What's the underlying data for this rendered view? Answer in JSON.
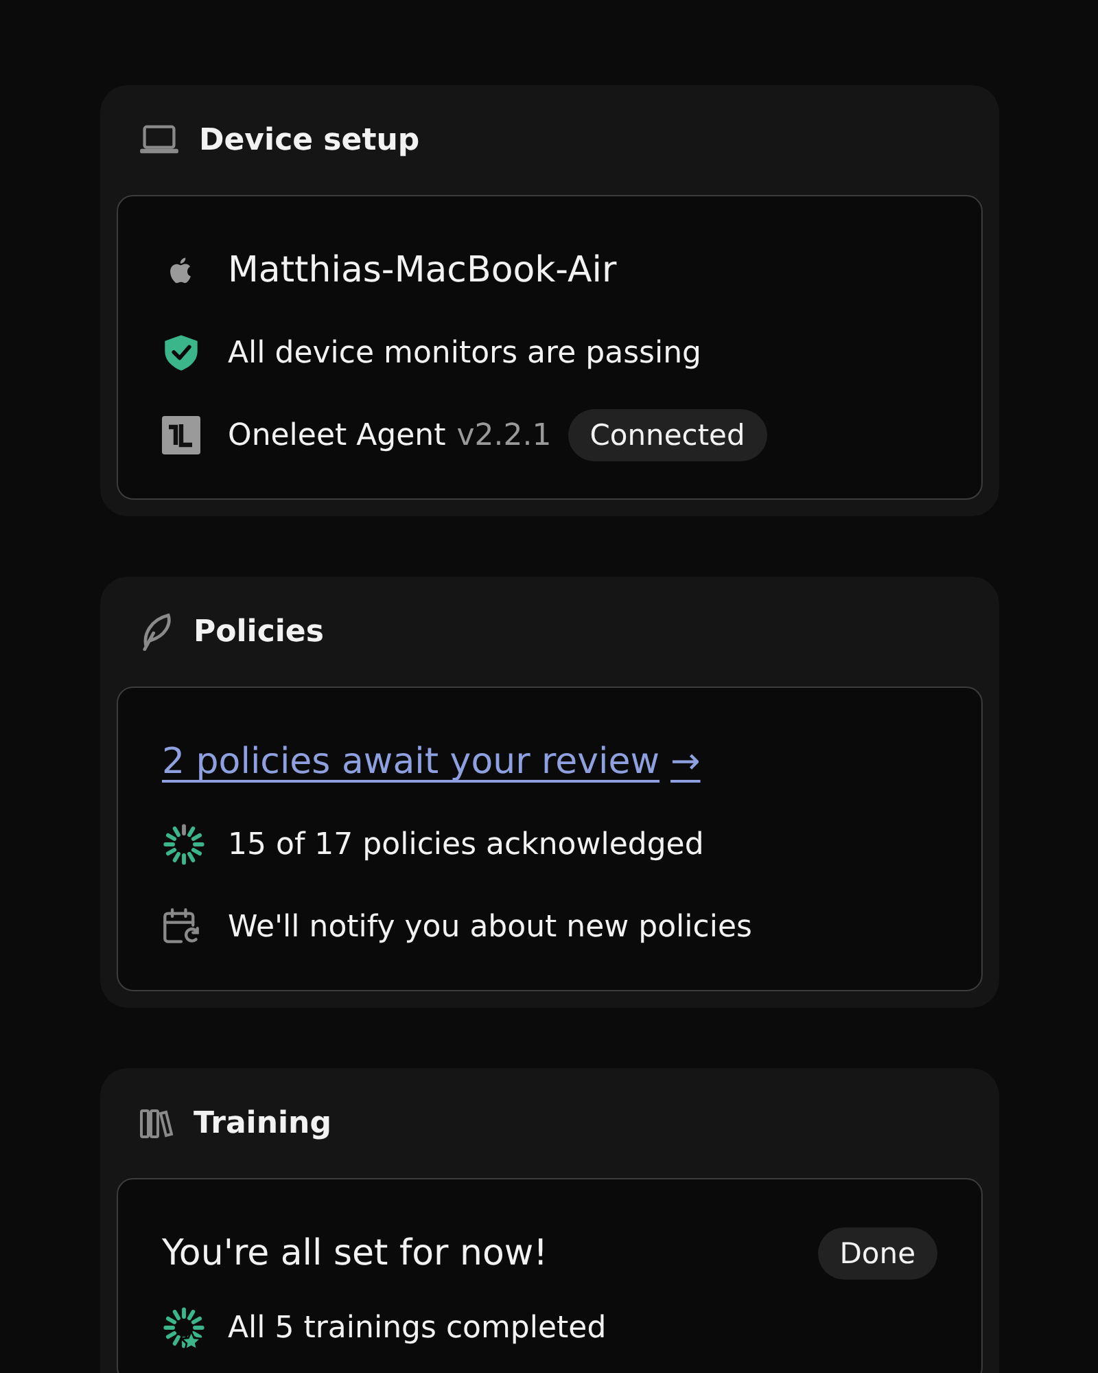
{
  "cards": [
    {
      "kind": "device",
      "title": "Device setup",
      "items": [
        {
          "kind": "device_name",
          "text": "Matthias-MacBook-Air"
        },
        {
          "kind": "shield",
          "text": "All device monitors are passing"
        },
        {
          "kind": "agent",
          "text": "Oneleet Agent",
          "version": "v2.2.1",
          "badge": "Connected"
        }
      ]
    },
    {
      "kind": "policies",
      "title": "Policies",
      "items": [
        {
          "kind": "link",
          "text": "2 policies await your review",
          "arrow": "→"
        },
        {
          "kind": "progress",
          "text": "15 of 17 policies acknowledged"
        },
        {
          "kind": "calendar",
          "text": "We'll notify you about new policies"
        }
      ]
    },
    {
      "kind": "training",
      "title": "Training",
      "items": [
        {
          "kind": "heading",
          "text": "You're all set for now!",
          "badge": "Done"
        },
        {
          "kind": "award",
          "text": "All 5 trainings completed"
        }
      ]
    }
  ]
}
